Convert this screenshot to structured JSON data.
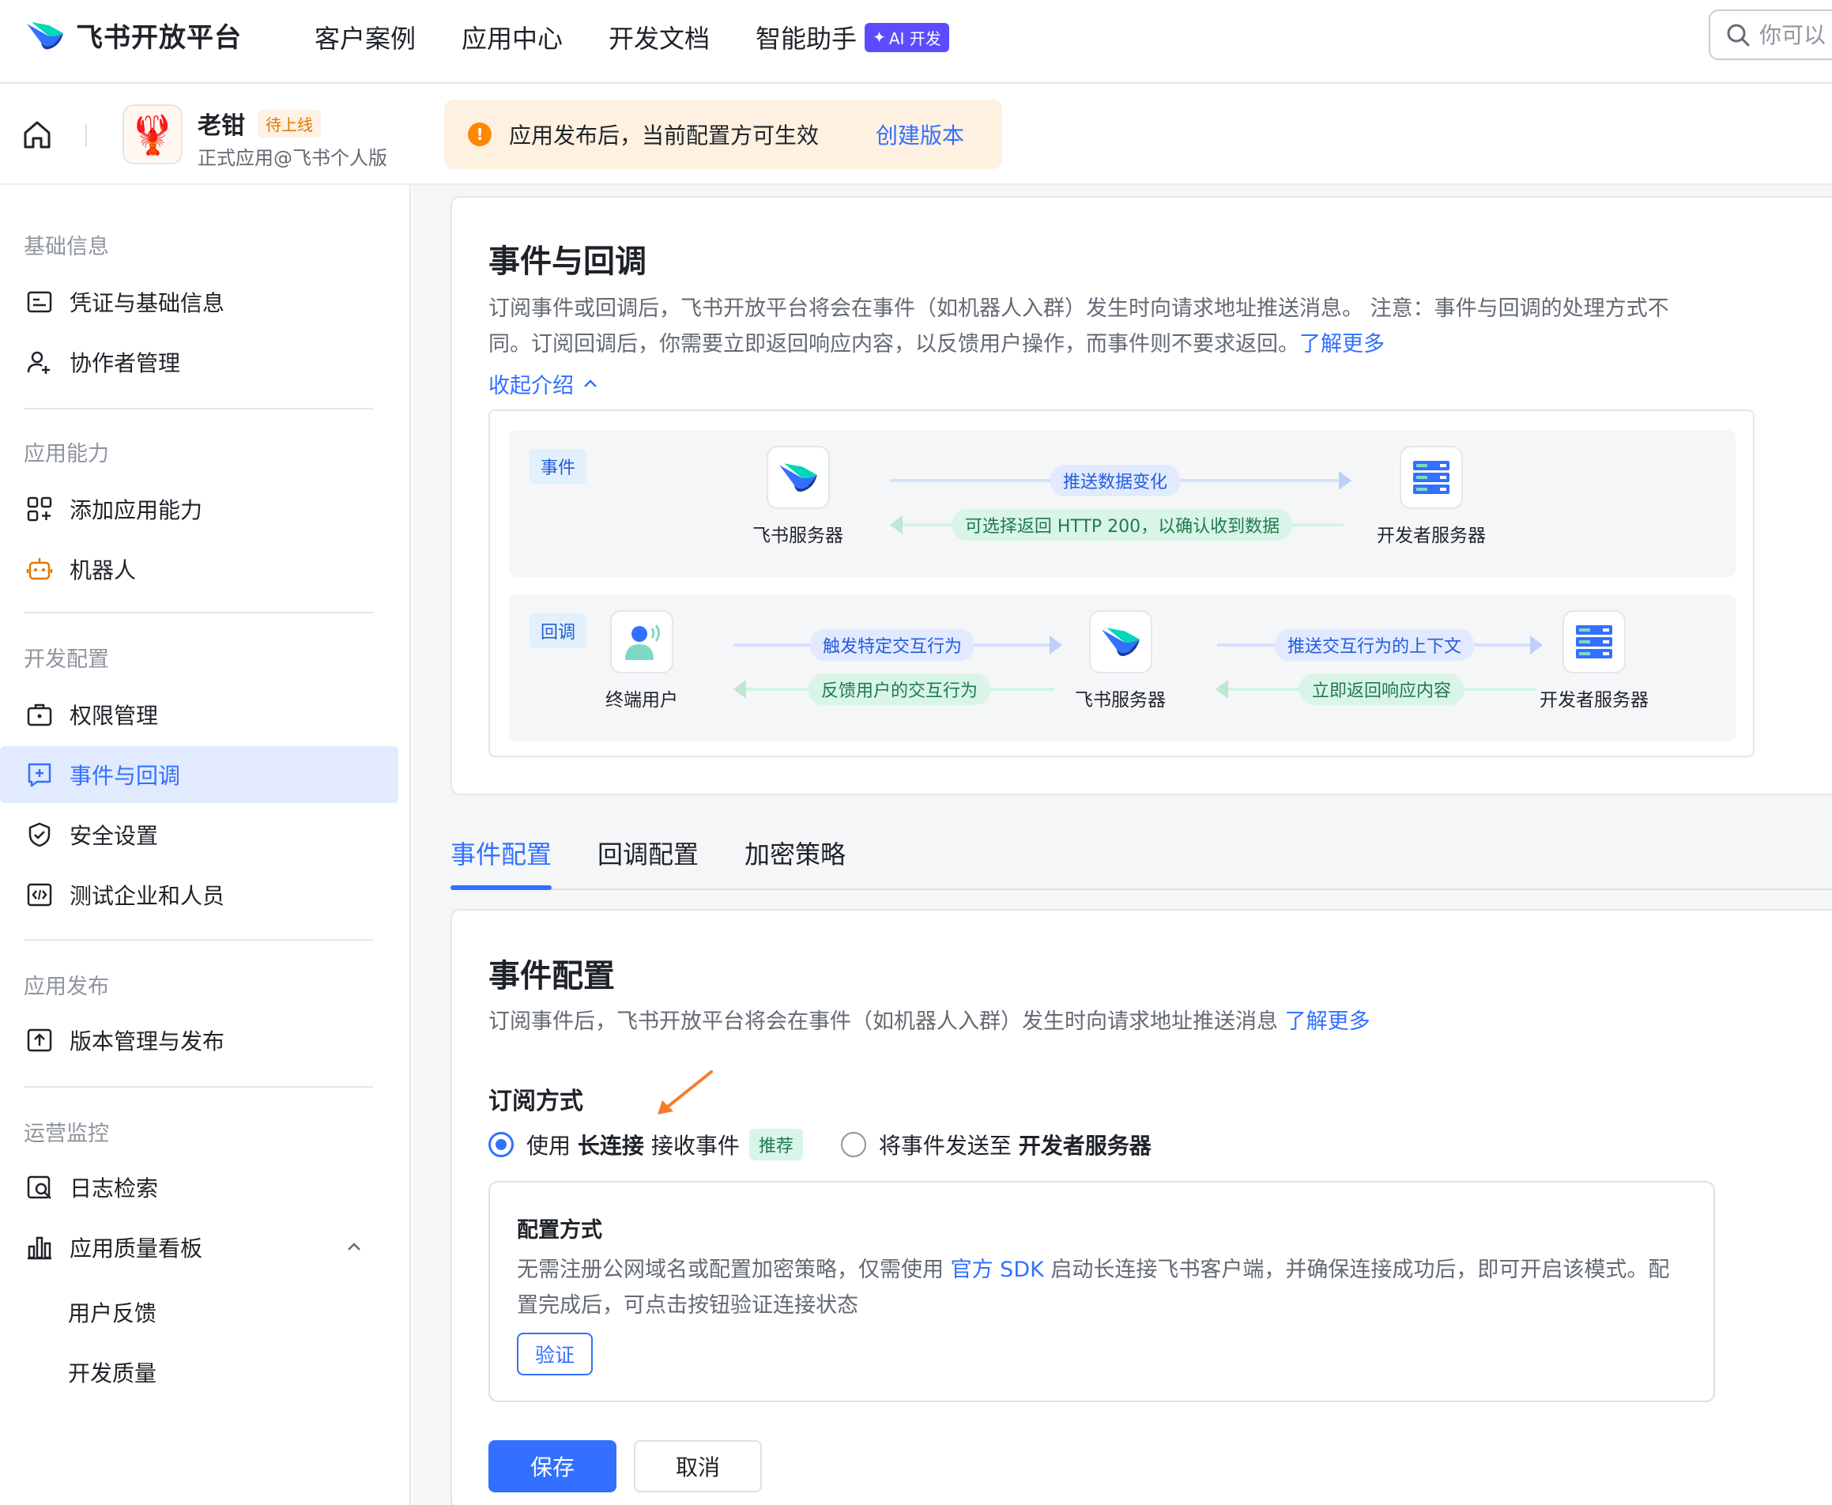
{
  "topnav": {
    "brand": "飞书开放平台",
    "links": [
      "客户案例",
      "应用中心",
      "开发文档",
      "智能助手"
    ],
    "ai_badge": "AI 开发",
    "search_placeholder": "你可以"
  },
  "appbar": {
    "app_name": "老钳",
    "app_status": "待上线",
    "app_sub": "正式应用@飞书个人版",
    "notice_text": "应用发布后，当前配置方可生效",
    "notice_link": "创建版本"
  },
  "sidebar": {
    "groups": [
      {
        "title": "基础信息",
        "items": [
          "凭证与基础信息",
          "协作者管理"
        ]
      },
      {
        "title": "应用能力",
        "items": [
          "添加应用能力",
          "机器人"
        ]
      },
      {
        "title": "开发配置",
        "items": [
          "权限管理",
          "事件与回调",
          "安全设置",
          "测试企业和人员"
        ]
      },
      {
        "title": "应用发布",
        "items": [
          "版本管理与发布"
        ]
      },
      {
        "title": "运营监控",
        "items": [
          "日志检索",
          "应用质量看板"
        ]
      }
    ],
    "sub_items": [
      "用户反馈",
      "开发质量"
    ]
  },
  "intro": {
    "title": "事件与回调",
    "desc_1": "订阅事件或回调后，飞书开放平台将会在事件（如机器人入群）发生时向请求地址推送消息。 注意：事件与回调的处理方式不",
    "desc_2": "同。订阅回调后，你需要立即返回响应内容，以反馈用户操作，而事件则不要求返回。",
    "learn_more": "了解更多",
    "collapse": "收起介绍"
  },
  "flow": {
    "event": {
      "tag": "事件",
      "from": "飞书服务器",
      "to": "开发者服务器",
      "push": "推送数据变化",
      "reply": "可选择返回 HTTP 200，以确认收到数据"
    },
    "callback": {
      "tag": "回调",
      "user": "终端用户",
      "server": "飞书服务器",
      "dev": "开发者服务器",
      "trigger": "触发特定交互行为",
      "feedback": "反馈用户的交互行为",
      "push_ctx": "推送交互行为的上下文",
      "respond": "立即返回响应内容"
    }
  },
  "tabs": [
    "事件配置",
    "回调配置",
    "加密策略"
  ],
  "event_config": {
    "title": "事件配置",
    "desc": "订阅事件后，飞书开放平台将会在事件（如机器人入群）发生时向请求地址推送消息",
    "learn_more": "了解更多",
    "sub_title": "订阅方式",
    "opt1_pre": "使用",
    "opt1_bold": "长连接",
    "opt1_post": "接收事件",
    "opt1_badge": "推荐",
    "opt2_pre": "将事件发送至",
    "opt2_bold": "开发者服务器",
    "config_title": "配置方式",
    "config_desc_pre": "无需注册公网域名或配置加密策略，仅需使用",
    "config_desc_link": "官方 SDK",
    "config_desc_post": "启动长连接飞书客户端，并确保连接成功后，即可开启该模式。配置完成后，可点击按钮验证连接状态",
    "verify": "验证",
    "save": "保存",
    "cancel": "取消"
  },
  "colors": {
    "primary": "#3370ff",
    "warning": "#ff8800",
    "success": "#207a4e"
  }
}
